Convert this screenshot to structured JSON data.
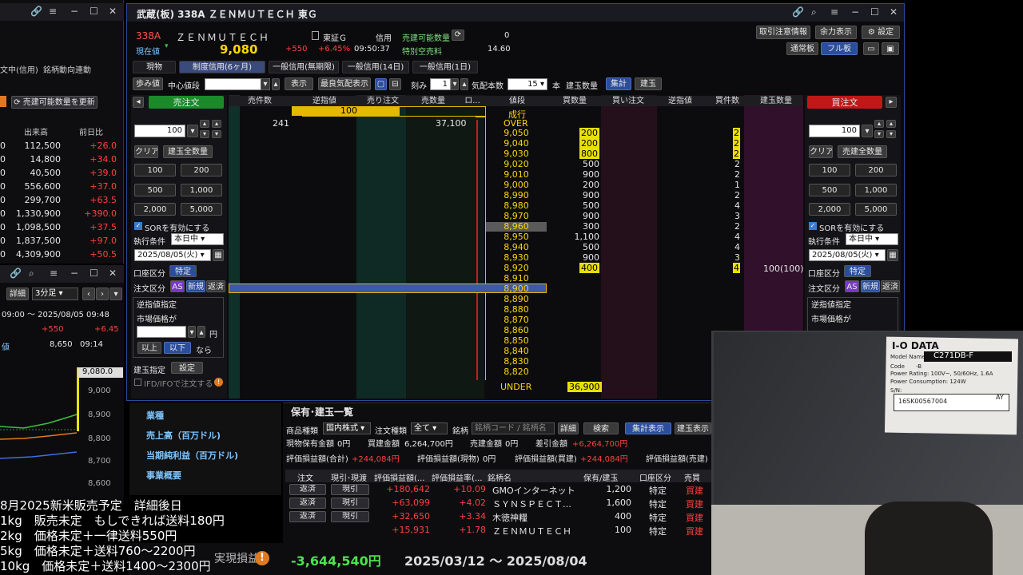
{
  "main_window": {
    "title": "武蔵(板) 338A ＺＥＮＭＵＴＥＣＨ 東Ｇ",
    "code": "338A",
    "name": "ＺＥＮＭＵＴＥＣＨ",
    "current_label": "現在値",
    "current_price": "9,080",
    "change": "+550",
    "change_pct": "+6.45%",
    "time": "09:50:37",
    "market": "東証Ｇ",
    "credit_label": "信用",
    "sell_avail_label": "売建可能数量",
    "sell_avail_value": "0",
    "special_label": "特別空売料",
    "special_value": "14.60",
    "btn_notice": "取引注意情報",
    "btn_remain": "余力表示",
    "btn_settings": "設定",
    "btn_normal": "通常板",
    "btn_full": "フル板",
    "tabs": [
      "現物",
      "制度信用(6ヶ月)",
      "一般信用(無期限)",
      "一般信用(14日)",
      "一般信用(1日)"
    ],
    "toolbar": {
      "ayumi": "歩み値",
      "center_label": "中心値段",
      "display": "表示",
      "best_quote": "最良気配表示",
      "tick_label": "刻み",
      "tick_value": "1",
      "qty_label": "気配本数",
      "qty_value": "15",
      "qty_unit": "本",
      "position_qty": "建玉数量",
      "aggregate": "集計",
      "position": "建玉"
    }
  },
  "sell_panel": {
    "header": "売注文",
    "qty": "100",
    "clear": "クリア",
    "all_position": "建玉全数量",
    "q100": "100",
    "q200": "200",
    "q500": "500",
    "q1000": "1,000",
    "q2000": "2,000",
    "q5000": "5,000",
    "sor": "SORを有効にする",
    "exec_label": "執行条件",
    "exec_value": "本日中",
    "date": "2025/08/05(火)",
    "account_label": "口座区分",
    "account_value": "特定",
    "order_type_label": "注文区分",
    "as": "AS",
    "new": "新規",
    "repay": "返済",
    "stop_label": "逆指値指定",
    "market_price": "市場価格が",
    "yen": "円",
    "above": "以上",
    "below": "以下",
    "nara": "なら",
    "position_spec": "建玉指定",
    "setting": "設定",
    "ifd": "IFD/IFOで注文する"
  },
  "buy_panel": {
    "header": "買注文",
    "qty": "100",
    "clear": "クリア",
    "all_qty": "売建全数量",
    "q100": "100",
    "q200": "200",
    "q500": "500",
    "q1000": "1,000",
    "q2000": "2,000",
    "q5000": "5,000",
    "sor": "SORを有効にする",
    "exec_label": "執行条件",
    "exec_value": "本日中",
    "date": "2025/08/05(火)",
    "account_label": "口座区分",
    "account_value": "特定",
    "order_type_label": "注文区分",
    "as": "AS",
    "new": "新規",
    "repay": "返済",
    "stop_label": "逆指値指定",
    "market_price": "市場価格が"
  },
  "board": {
    "headers": [
      "売件数",
      "逆指値",
      "売り注文",
      "売数量",
      "ロ...",
      "値段",
      "買数量",
      "買い注文",
      "逆指値",
      "買件数",
      "建玉数量"
    ],
    "top_stop_value": "100",
    "sell_count_total": "241",
    "sell_qty_total": "37,100",
    "nariyuki": "成行",
    "over": "OVER",
    "under": "UNDER",
    "under_qty": "36,900",
    "position_qty": "100(100)",
    "rows": [
      {
        "price": "9,050",
        "buy": "200",
        "count": "2",
        "hl": true
      },
      {
        "price": "9,040",
        "buy": "200",
        "count": "2",
        "hl": true
      },
      {
        "price": "9,030",
        "buy": "800",
        "count": "2",
        "hl": true
      },
      {
        "price": "9,020",
        "buy": "500",
        "count": "2",
        "hl": false
      },
      {
        "price": "9,010",
        "buy": "900",
        "count": "2",
        "hl": false
      },
      {
        "price": "9,000",
        "buy": "200",
        "count": "1",
        "hl": false
      },
      {
        "price": "8,990",
        "buy": "900",
        "count": "2",
        "hl": false
      },
      {
        "price": "8,980",
        "buy": "500",
        "count": "4",
        "hl": false
      },
      {
        "price": "8,970",
        "buy": "900",
        "count": "3",
        "hl": false
      },
      {
        "price": "8,960",
        "buy": "300",
        "count": "2",
        "hl": false
      },
      {
        "price": "8,950",
        "buy": "1,100",
        "count": "4",
        "hl": false
      },
      {
        "price": "8,940",
        "buy": "500",
        "count": "4",
        "hl": false
      },
      {
        "price": "8,930",
        "buy": "900",
        "count": "3",
        "hl": false
      },
      {
        "price": "8,920",
        "buy": "400",
        "count": "4",
        "hl": true
      },
      {
        "price": "8,910",
        "buy": "",
        "count": "",
        "hl": false
      },
      {
        "price": "8,900",
        "buy": "",
        "count": "",
        "hl": false
      },
      {
        "price": "8,890",
        "buy": "",
        "count": "",
        "hl": false
      },
      {
        "price": "8,880",
        "buy": "",
        "count": "",
        "hl": false
      },
      {
        "price": "8,870",
        "buy": "",
        "count": "",
        "hl": false
      },
      {
        "price": "8,860",
        "buy": "",
        "count": "",
        "hl": false
      },
      {
        "price": "8,850",
        "buy": "",
        "count": "",
        "hl": false
      },
      {
        "price": "8,840",
        "buy": "",
        "count": "",
        "hl": false
      },
      {
        "price": "8,830",
        "buy": "",
        "count": "",
        "hl": false
      },
      {
        "price": "8,820",
        "buy": "",
        "count": "",
        "hl": false
      }
    ]
  },
  "left_panel": {
    "tabs": [
      "文中(信用)",
      "銘柄動向連動"
    ],
    "update_btn": "売建可能数量を更新",
    "col_volume": "出来高",
    "col_change": "前日比",
    "rows": [
      {
        "v": "112,500",
        "c": "+26.0"
      },
      {
        "v": "14,800",
        "c": "+34.0"
      },
      {
        "v": "40,500",
        "c": "+39.0"
      },
      {
        "v": "556,600",
        "c": "+37.0"
      },
      {
        "v": "299,700",
        "c": "+63.5"
      },
      {
        "v": "1,330,900",
        "c": "+390.0"
      },
      {
        "v": "1,098,500",
        "c": "+37.5"
      },
      {
        "v": "1,837,500",
        "c": "+97.0"
      },
      {
        "v": "4,309,900",
        "c": "+50.5"
      }
    ],
    "chart_detail": "詳細",
    "chart_interval": "3分足",
    "chart_range": "09:00 ～ 2025/08/05 09:48",
    "chart_change": "+550",
    "chart_change_pct": "+6.45",
    "chart_last": "8,650",
    "chart_time": "09:14",
    "chart_label": "値",
    "axis": [
      "9,080.0",
      "9,000",
      "8,900",
      "8,800",
      "8,700",
      "8,600"
    ]
  },
  "holdings": {
    "title": "保有･建玉一覧",
    "filter_label1": "商品種類",
    "filter_value1": "国内株式",
    "filter_label2": "注文種類",
    "filter_value2": "全て",
    "filter_label3": "銘柄",
    "filter_placeholder": "銘柄コード / 銘柄名",
    "btn_detail": "詳細",
    "btn_search": "検索",
    "btn_aggregate": "集計表示",
    "btn_position": "建玉表示",
    "summary1": {
      "cash_label": "現物保有金額",
      "cash": "0円",
      "buy_label": "買建金額",
      "buy": "6,264,700円",
      "sell_label": "売建金額",
      "sell": "0円",
      "diff_label": "差引金額",
      "diff": "+6,264,700円"
    },
    "summary2": {
      "total_label": "評価損益額(合計)",
      "total": "+244,084円",
      "cash_label": "評価損益額(現物)",
      "cash": "0円",
      "buy_label": "評価損益額(買建)",
      "buy": "+244,084円",
      "sell_label": "評価損益額(売建)"
    },
    "headers": [
      "注文",
      "現引･現渡",
      "評価損益額(...",
      "評価損益率(...",
      "銘柄名",
      "保有/建玉",
      "口座区分",
      "売買"
    ],
    "rows": [
      {
        "order": "返済",
        "pull": "現引",
        "pl": "+180,642",
        "rate": "+10.09",
        "name": "GMOインターネット",
        "qty": "1,200",
        "acct": "特定",
        "side": "買建"
      },
      {
        "order": "返済",
        "pull": "現引",
        "pl": "+63,099",
        "rate": "+4.02",
        "name": "ＳＹＮＳＰＥＣＴ…",
        "qty": "1,600",
        "acct": "特定",
        "side": "買建"
      },
      {
        "order": "返済",
        "pull": "現引",
        "pl": "+32,650",
        "rate": "+3.34",
        "name": "木徳神糧",
        "qty": "400",
        "acct": "特定",
        "side": "買建"
      },
      {
        "order": "",
        "pull": "",
        "pl": "+15,931",
        "rate": "+1.78",
        "name": "ＺＥＮＭＵＴＥＣＨ",
        "qty": "100",
        "acct": "特定",
        "side": "買建"
      }
    ]
  },
  "info_panel": {
    "items": [
      "業種",
      "売上高（百万ドル)",
      "当期純利益（百万ドル)",
      "事業概要"
    ]
  },
  "overlay": {
    "lines": [
      "8月2025新米販売予定　詳細後日",
      "1kg　販売未定　もしできれば送料180円",
      "2kg　価格未定＋一律送料550円",
      "5kg　価格未定＋送料760～2200円",
      "10kg　価格未定＋送料1400～2300円"
    ],
    "total_pl_label": "実現損益",
    "total_pl": "-3,644,540円",
    "period": "2025/03/12 ～ 2025/08/04"
  },
  "device_label": {
    "brand": "I-O DATA",
    "model_label": "Model Name",
    "model": "C271DB-F",
    "code_label": "Code",
    "code": "-B",
    "rating": "Power Rating: 100V~, 50/60Hz, 1.6A",
    "consumption": "Power Consumption: 124W",
    "sn_label": "S/N:",
    "serial": "16SK00567004",
    "serial_suffix": "AY"
  }
}
